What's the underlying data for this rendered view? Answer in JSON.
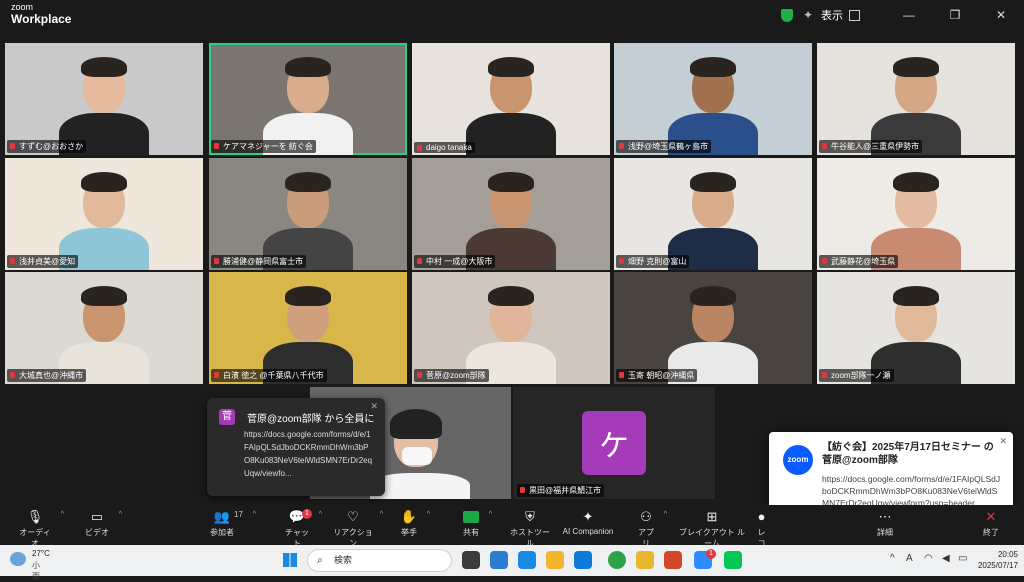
{
  "app": {
    "logo_small": "zoom",
    "logo_big": "Workplace",
    "view_label": "表示"
  },
  "participants": [
    {
      "name": "すずむ@おおさか",
      "bg": "#c9c9c9",
      "skin": "#e4b99c",
      "shirt": "#222"
    },
    {
      "name": "ケアマネジャーを 紡ぐ会",
      "bg": "#7a766f",
      "skin": "#d9ad8c",
      "shirt": "#f1f1f1"
    },
    {
      "name": "daigo tanaka",
      "bg": "#e8e2dc",
      "skin": "#c9956f",
      "shirt": "#222"
    },
    {
      "name": "浅野@埼玉県鶴ヶ島市",
      "bg": "#c4ced5",
      "skin": "#a0704f",
      "shirt": "#2a4f8a"
    },
    {
      "name": "牛谷能人@三重県伊勢市",
      "bg": "#e5e2dd",
      "skin": "#d3a684",
      "shirt": "#3a3a3a"
    },
    {
      "name": "浅井貞美@愛知",
      "bg": "#efe7dc",
      "skin": "#e0b99b",
      "shirt": "#8ec6d8"
    },
    {
      "name": "勝浦健@静岡県富士市",
      "bg": "#8a8680",
      "skin": "#c99d7c",
      "shirt": "#444"
    },
    {
      "name": "中村 一成@大阪市",
      "bg": "#a39f98",
      "skin": "#c89470",
      "shirt": "#4a3a33"
    },
    {
      "name": "畑野 克則@富山",
      "bg": "#e7e6e2",
      "skin": "#d9ad8c",
      "shirt": "#1f2c45"
    },
    {
      "name": "武藤静花@埼玉県",
      "bg": "#eeeae5",
      "skin": "#e2bba0",
      "shirt": "#c88b72"
    },
    {
      "name": "大城真也@沖縄市",
      "bg": "#dcd9d3",
      "skin": "#c9956f",
      "shirt": "#e9e4da"
    },
    {
      "name": "白濱 徳之 @千葉県八千代市",
      "bg": "#d9b64a",
      "skin": "#d0a07c",
      "shirt": "#2d2d2d"
    },
    {
      "name": "菅原@zoom部隊",
      "bg": "#cfc6bd",
      "skin": "#e0b59a",
      "shirt": "#ece6df"
    },
    {
      "name": "玉寄 朝昭@沖縄県",
      "bg": "#4a4440",
      "skin": "#b98562",
      "shirt": "#e9e9e9"
    },
    {
      "name": "zoom部隊一ノ瀬",
      "bg": "#e6e4e0",
      "skin": "#e0b99b",
      "shirt": "#2e2e2e"
    },
    {
      "name": "",
      "bg": "#cfd3d6",
      "skin": "#e3bea3",
      "shirt": "#f4f4f4"
    },
    {
      "name": "黒田@福井県鯖江市",
      "avatar": "ケ"
    }
  ],
  "chat_popup": {
    "avatar": "菅",
    "title": "菅原@zoom部隊 から全員に",
    "message": "https://docs.google.com/forms/d/e/1FAIpQLSdJboDCKRmmDhWm3bPO8Ku083NeV6teiWldSMN7ErDr2eqUqw/viewfo..."
  },
  "notification": {
    "logo": "zoom",
    "title": "【紡ぐ会】2025年7月17日セミナー の 菅原@zoom部隊",
    "body": "https://docs.google.com/forms/d/e/1FAIpQLSdJboDCKRmmDhWm3bPO8Ku083NeV6teiWldSMN7ErDr2eqUqw/viewform?usp=header"
  },
  "toolbar": {
    "audio": "オーディオ",
    "video": "ビデオ",
    "participants": "参加者",
    "participants_count": "17",
    "chat": "チャット",
    "chat_badge": "1",
    "reactions": "リアクション",
    "raise_hand": "挙手",
    "share": "共有",
    "host_tools": "ホストツール",
    "ai_companion": "AI Companion",
    "apps": "アプリ",
    "breakout": "ブレイクアウト ルーム",
    "record": "レコーディング",
    "more": "詳細",
    "end": "終了"
  },
  "taskbar": {
    "temp": "27°C",
    "condition": "小雨",
    "search": "検索",
    "time": "20:05",
    "date": "2025/07/17",
    "app_badge": "1"
  }
}
